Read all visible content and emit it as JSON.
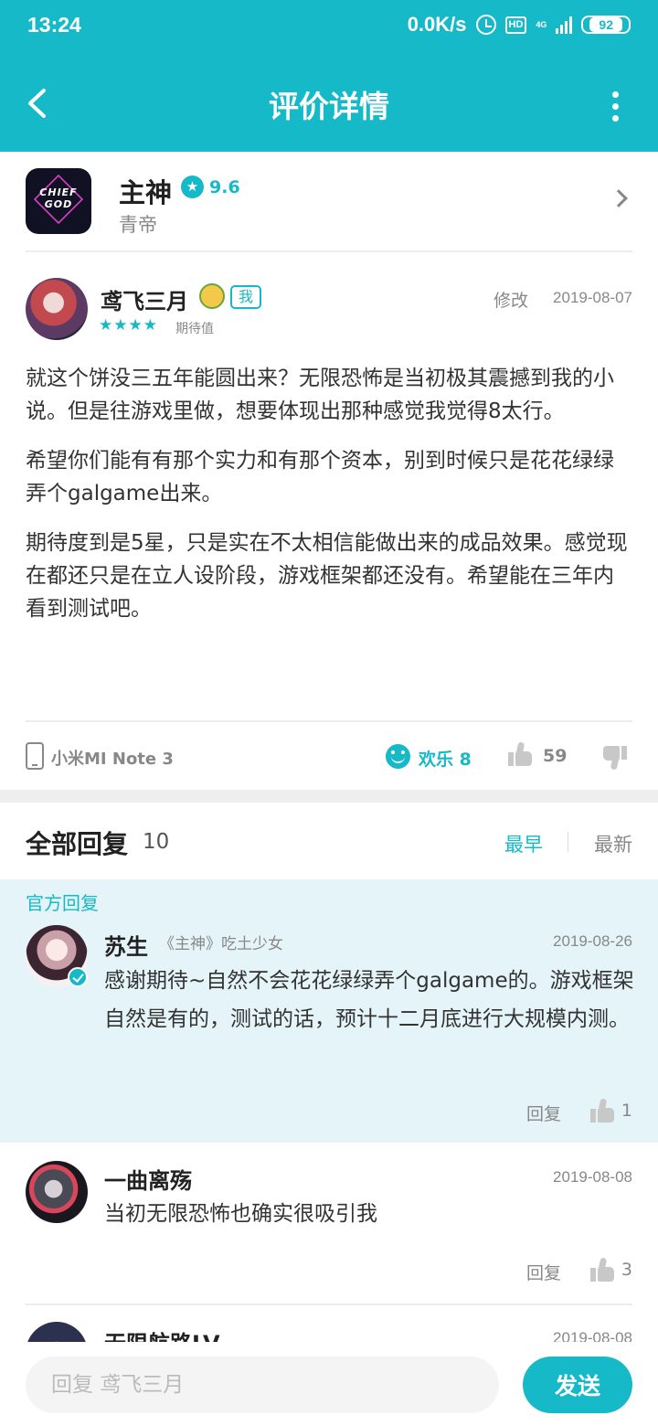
{
  "status_bar": {
    "time": "13:24",
    "speed": "0.0K/s",
    "hd": "HD",
    "network": "4G",
    "battery": "92"
  },
  "header": {
    "title": "评价详情"
  },
  "game": {
    "name": "主神",
    "rating": "9.6",
    "developer": "青帝",
    "logo_text": "CHIEF GOD"
  },
  "review": {
    "author": "鸢飞三月",
    "me_tag": "我",
    "stars": "★★★★",
    "star_label": "期待值",
    "edit_label": "修改",
    "date": "2019-08-07",
    "paragraphs": [
      "就这个饼没三五年能圆出来？无限恐怖是当初极其震撼到我的小说。但是往游戏里做，想要体现出那种感觉我觉得8太行。",
      "希望你们能有有那个实力和有那个资本，别到时候只是花花绿绿弄个galgame出来。",
      "期待度到是5星，只是实在不太相信能做出来的成品效果。感觉现在都还只是在立人设阶段，游戏框架都还没有。希望能在三年内看到测试吧。"
    ],
    "device": "小米MI Note 3",
    "fun": "欢乐 8",
    "likes": "59"
  },
  "replies": {
    "title": "全部回复",
    "count": "10",
    "sort_earliest": "最早",
    "sort_newest": "最新",
    "official_label": "官方回复",
    "official": {
      "name": "苏生",
      "role": "《主神》吃土少女",
      "date": "2019-08-26",
      "text": "感谢期待~自然不会花花绿绿弄个galgame的。游戏框架自然是有的，测试的话，预计十二月底进行大规模内测。",
      "reply_label": "回复",
      "likes": "1"
    },
    "items": [
      {
        "name": "一曲离殇",
        "date": "2019-08-08",
        "text": "当初无限恐怖也确实很吸引我",
        "reply_label": "回复",
        "likes": "3"
      },
      {
        "name": "无限航路LV",
        "date": "2019-08-08"
      }
    ]
  },
  "bottom_bar": {
    "placeholder": "回复 鸢飞三月",
    "send_label": "发送"
  },
  "colors": {
    "accent": "#16b9c8",
    "official_bg": "#e4f4f8"
  }
}
